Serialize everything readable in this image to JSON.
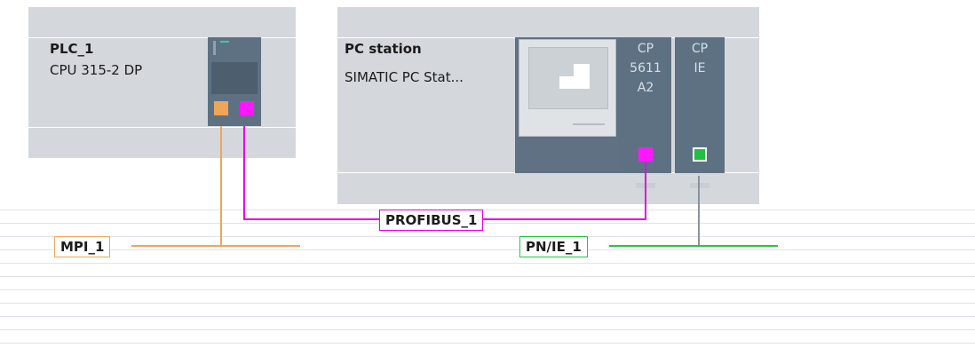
{
  "devices": {
    "plc": {
      "name": "PLC_1",
      "type": "CPU 315-2 DP"
    },
    "pc": {
      "name": "PC station",
      "type": "SIMATIC PC Stat...",
      "modules": {
        "cp5611": {
          "line1": "CP",
          "line2": "5611",
          "line3": "A2"
        },
        "cpie": {
          "line1": "CP",
          "line2": "IE"
        }
      }
    }
  },
  "networks": {
    "mpi": {
      "label": "MPI_1",
      "color": "#f0a657"
    },
    "profibus": {
      "label": "PROFIBUS_1",
      "color": "#e600e6"
    },
    "pnie": {
      "label": "PN/IE_1",
      "color": "#27c440"
    }
  },
  "colors": {
    "device_body": "#d4d8dd",
    "module": "#5e7183"
  }
}
